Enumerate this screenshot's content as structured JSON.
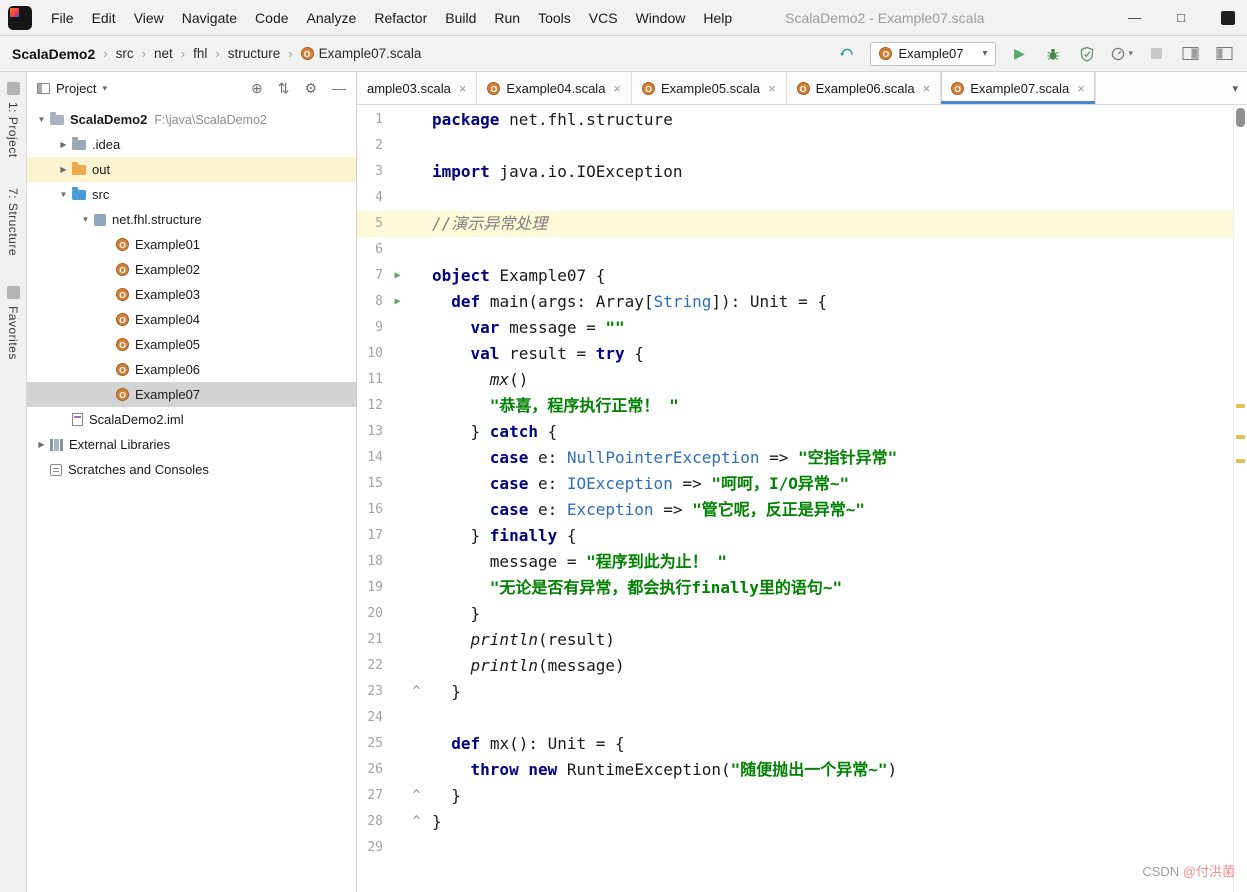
{
  "titlebar": {
    "menus": [
      "File",
      "Edit",
      "View",
      "Navigate",
      "Code",
      "Analyze",
      "Refactor",
      "Build",
      "Run",
      "Tools",
      "VCS",
      "Window",
      "Help"
    ],
    "title": "ScalaDemo2 - Example07.scala"
  },
  "toolbar": {
    "breadcrumb": [
      {
        "label": "ScalaDemo2",
        "bold": true
      },
      {
        "label": "src"
      },
      {
        "label": "net"
      },
      {
        "label": "fhl"
      },
      {
        "label": "structure"
      },
      {
        "label": "Example07.scala",
        "icon": "scala-object"
      }
    ],
    "run_config": {
      "value": "Example07"
    }
  },
  "tool_window_bar": {
    "top": [
      "1: Project",
      "7: Structure"
    ],
    "bottom": [
      "Favorites"
    ]
  },
  "project_panel": {
    "header": {
      "title": "Project"
    },
    "tree": [
      {
        "indent": 0,
        "arrow": "expanded",
        "icon": "project",
        "label": "ScalaDemo2",
        "detail": "F:\\java\\ScalaDemo2",
        "bold": true
      },
      {
        "indent": 1,
        "arrow": "collapsed",
        "icon": "folder-gray",
        "label": ".idea"
      },
      {
        "indent": 1,
        "arrow": "collapsed",
        "icon": "folder-orange",
        "label": "out",
        "row": "yellow"
      },
      {
        "indent": 1,
        "arrow": "expanded",
        "icon": "folder-blue",
        "label": "src"
      },
      {
        "indent": 2,
        "arrow": "expanded",
        "icon": "package",
        "label": "net.fhl.structure"
      },
      {
        "indent": 3,
        "icon": "scala",
        "label": "Example01"
      },
      {
        "indent": 3,
        "icon": "scala",
        "label": "Example02"
      },
      {
        "indent": 3,
        "icon": "scala",
        "label": "Example03"
      },
      {
        "indent": 3,
        "icon": "scala",
        "label": "Example04"
      },
      {
        "indent": 3,
        "icon": "scala",
        "label": "Example05"
      },
      {
        "indent": 3,
        "icon": "scala",
        "label": "Example06"
      },
      {
        "indent": 3,
        "icon": "scala",
        "label": "Example07",
        "selected": true
      },
      {
        "indent": 1,
        "icon": "module-file",
        "label": "ScalaDemo2.iml"
      },
      {
        "indent": 0,
        "arrow": "collapsed",
        "icon": "library",
        "label": "External Libraries"
      },
      {
        "indent": 0,
        "icon": "scratches",
        "label": "Scratches and Consoles"
      }
    ]
  },
  "editor": {
    "tabs": [
      {
        "label": "ample03.scala",
        "truncated": true
      },
      {
        "label": "Example04.scala"
      },
      {
        "label": "Example05.scala"
      },
      {
        "label": "Example06.scala"
      },
      {
        "label": "Example07.scala",
        "active": true
      }
    ],
    "lines": [
      {
        "num": 1,
        "tokens": [
          {
            "c": "k",
            "t": "package"
          },
          {
            "c": "p",
            "t": " net.fhl.structure"
          }
        ]
      },
      {
        "num": 2,
        "tokens": []
      },
      {
        "num": 3,
        "tokens": [
          {
            "c": "k",
            "t": "import"
          },
          {
            "c": "p",
            "t": " java.io.IOException"
          }
        ]
      },
      {
        "num": 4,
        "tokens": []
      },
      {
        "num": 5,
        "highlight": true,
        "tokens": [
          {
            "c": "c",
            "t": "//演示异常处理"
          }
        ]
      },
      {
        "num": 6,
        "tokens": []
      },
      {
        "num": 7,
        "gutter": "run",
        "tokens": [
          {
            "c": "k",
            "t": "object"
          },
          {
            "c": "p",
            "t": " Example07 {"
          }
        ]
      },
      {
        "num": 8,
        "gutter": "run",
        "tokens": [
          {
            "c": "p",
            "t": "  "
          },
          {
            "c": "k",
            "t": "def"
          },
          {
            "c": "p",
            "t": " "
          },
          {
            "c": "m",
            "t": "main"
          },
          {
            "c": "p",
            "t": "(args: Array["
          },
          {
            "c": "t",
            "t": "String"
          },
          {
            "c": "p",
            "t": "]): Unit = {"
          }
        ]
      },
      {
        "num": 9,
        "tokens": [
          {
            "c": "p",
            "t": "    "
          },
          {
            "c": "k",
            "t": "var"
          },
          {
            "c": "p",
            "t": " message = "
          },
          {
            "c": "s",
            "t": "\"\""
          }
        ]
      },
      {
        "num": 10,
        "tokens": [
          {
            "c": "p",
            "t": "    "
          },
          {
            "c": "k",
            "t": "val"
          },
          {
            "c": "p",
            "t": " result = "
          },
          {
            "c": "k",
            "t": "try"
          },
          {
            "c": "p",
            "t": " {"
          }
        ]
      },
      {
        "num": 11,
        "tokens": [
          {
            "c": "p",
            "t": "      "
          },
          {
            "c": "i",
            "t": "mx"
          },
          {
            "c": "p",
            "t": "()"
          }
        ]
      },
      {
        "num": 12,
        "tokens": [
          {
            "c": "p",
            "t": "      "
          },
          {
            "c": "s",
            "t": "\"恭喜，程序执行正常！ \""
          }
        ]
      },
      {
        "num": 13,
        "tokens": [
          {
            "c": "p",
            "t": "    } "
          },
          {
            "c": "k",
            "t": "catch"
          },
          {
            "c": "p",
            "t": " {"
          }
        ]
      },
      {
        "num": 14,
        "tokens": [
          {
            "c": "p",
            "t": "      "
          },
          {
            "c": "k",
            "t": "case"
          },
          {
            "c": "p",
            "t": " e: "
          },
          {
            "c": "t",
            "t": "NullPointerException"
          },
          {
            "c": "p",
            "t": " => "
          },
          {
            "c": "s",
            "t": "\"空指针异常\""
          }
        ]
      },
      {
        "num": 15,
        "tokens": [
          {
            "c": "p",
            "t": "      "
          },
          {
            "c": "k",
            "t": "case"
          },
          {
            "c": "p",
            "t": " e: "
          },
          {
            "c": "t",
            "t": "IOException"
          },
          {
            "c": "p",
            "t": " => "
          },
          {
            "c": "s",
            "t": "\"呵呵，I/O异常~\""
          }
        ]
      },
      {
        "num": 16,
        "tokens": [
          {
            "c": "p",
            "t": "      "
          },
          {
            "c": "k",
            "t": "case"
          },
          {
            "c": "p",
            "t": " e: "
          },
          {
            "c": "t",
            "t": "Exception"
          },
          {
            "c": "p",
            "t": " => "
          },
          {
            "c": "s",
            "t": "\"管它呢，反正是异常~\""
          }
        ]
      },
      {
        "num": 17,
        "tokens": [
          {
            "c": "p",
            "t": "    } "
          },
          {
            "c": "k",
            "t": "finally"
          },
          {
            "c": "p",
            "t": " {"
          }
        ]
      },
      {
        "num": 18,
        "tokens": [
          {
            "c": "p",
            "t": "      message = "
          },
          {
            "c": "s",
            "t": "\"程序到此为止！ \""
          }
        ]
      },
      {
        "num": 19,
        "tokens": [
          {
            "c": "p",
            "t": "      "
          },
          {
            "c": "s",
            "t": "\"无论是否有异常，都会执行finally里的语句~\""
          }
        ]
      },
      {
        "num": 20,
        "tokens": [
          {
            "c": "p",
            "t": "    }"
          }
        ]
      },
      {
        "num": 21,
        "tokens": [
          {
            "c": "p",
            "t": "    "
          },
          {
            "c": "i",
            "t": "println"
          },
          {
            "c": "p",
            "t": "(result)"
          }
        ]
      },
      {
        "num": 22,
        "tokens": [
          {
            "c": "p",
            "t": "    "
          },
          {
            "c": "i",
            "t": "println"
          },
          {
            "c": "p",
            "t": "(message)"
          }
        ]
      },
      {
        "num": 23,
        "gutter": "fold",
        "tokens": [
          {
            "c": "p",
            "t": "  }"
          }
        ]
      },
      {
        "num": 24,
        "tokens": []
      },
      {
        "num": 25,
        "tokens": [
          {
            "c": "p",
            "t": "  "
          },
          {
            "c": "k",
            "t": "def"
          },
          {
            "c": "p",
            "t": " "
          },
          {
            "c": "m",
            "t": "mx"
          },
          {
            "c": "p",
            "t": "(): Unit = {"
          }
        ]
      },
      {
        "num": 26,
        "tokens": [
          {
            "c": "p",
            "t": "    "
          },
          {
            "c": "k",
            "t": "throw"
          },
          {
            "c": "p",
            "t": " "
          },
          {
            "c": "k",
            "t": "new"
          },
          {
            "c": "p",
            "t": " RuntimeException("
          },
          {
            "c": "s",
            "t": "\"随便抛出一个异常~\""
          },
          {
            "c": "p",
            "t": ")"
          }
        ]
      },
      {
        "num": 27,
        "gutter": "fold",
        "tokens": [
          {
            "c": "p",
            "t": "  }"
          }
        ]
      },
      {
        "num": 28,
        "gutter": "fold",
        "tokens": [
          {
            "c": "p",
            "t": "}"
          }
        ]
      },
      {
        "num": 29,
        "tokens": []
      }
    ]
  },
  "watermark": {
    "prefix": "CSDN",
    "handle": "@付洪菌"
  },
  "icons": {
    "minimize": "—",
    "maximize": "□",
    "chevron-down": "▾",
    "close": "×",
    "run": "▶",
    "expanded": "▼",
    "collapsed": "▶",
    "fold": "^",
    "breadcrumb-sep": "›",
    "crosshair": "⊕",
    "collapse-all": "⇅",
    "gear": "⚙",
    "hide": "—"
  },
  "colors": {
    "accent": "#4b87c8",
    "run_green": "#59a869",
    "keyword": "#000080",
    "string": "#008000",
    "comment": "#808080",
    "caret_line": "#fcf8d8",
    "selection": "#d4d4d4"
  }
}
